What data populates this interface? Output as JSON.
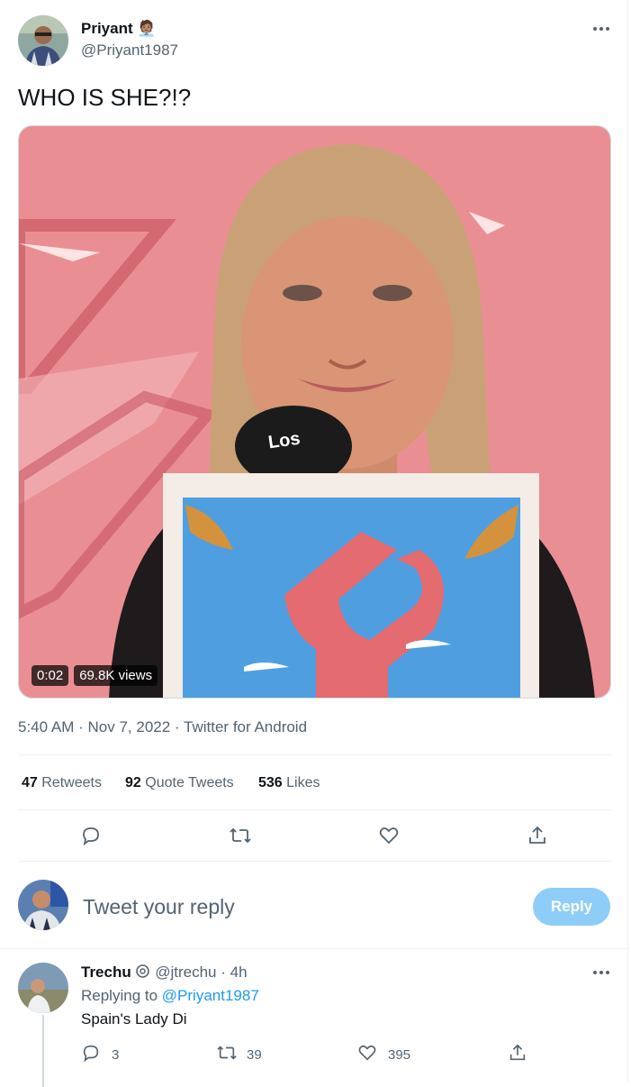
{
  "tweet": {
    "author_name": "Priyant",
    "author_emoji": "🧑🏽‍💼",
    "author_handle": "@Priyant1987",
    "more_icon": "more-horizontal-icon",
    "text": "WHO IS SHE?!?",
    "video": {
      "duration": "0:02",
      "views": "69.8K views",
      "mic_logo": "Los"
    },
    "meta": {
      "time": "5:40 AM",
      "date": "Nov 7, 2022",
      "source": "Twitter for Android",
      "sep": "·"
    },
    "stats": {
      "retweets_count": "47",
      "retweets_label": "Retweets",
      "quotes_count": "92",
      "quotes_label": "Quote Tweets",
      "likes_count": "536",
      "likes_label": "Likes"
    },
    "actions": [
      "reply-icon",
      "retweet-icon",
      "like-icon",
      "share-icon"
    ]
  },
  "composer": {
    "placeholder": "Tweet your reply",
    "button_label": "Reply"
  },
  "reply": {
    "author_name": "Trechu",
    "author_handle": "@jtrechu",
    "age": "· 4h",
    "replying_prefix": "Replying to",
    "replying_handle": "@Priyant1987",
    "text": "Spain's Lady Di",
    "reply_count": "3",
    "retweet_count": "39",
    "like_count": "395"
  },
  "colors": {
    "accent": "#1d9bf0",
    "reply_button": "#8ecdf8",
    "muted": "#536471"
  }
}
